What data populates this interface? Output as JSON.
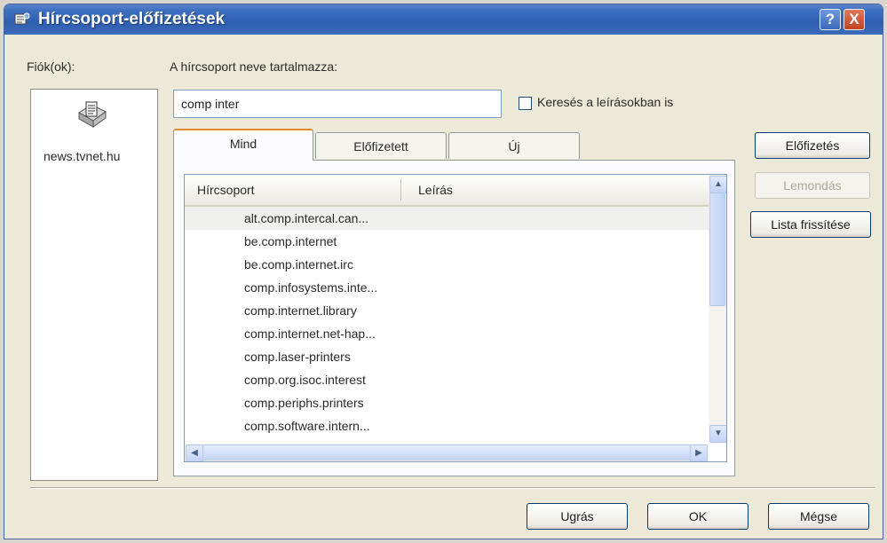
{
  "window": {
    "title": "Hírcsoport-előfizetések",
    "help_label": "?",
    "close_label": "X"
  },
  "accounts": {
    "label": "Fiók(ok):",
    "items": [
      {
        "name": "news.tvnet.hu"
      }
    ]
  },
  "search": {
    "label": "A hírcsoport neve tartalmazza:",
    "value": "comp inter",
    "checkbox_label": "Keresés a leírásokban is",
    "checkbox_checked": false
  },
  "tabs": [
    {
      "label": "Mind",
      "active": true
    },
    {
      "label": "Előfizetett",
      "active": false
    },
    {
      "label": "Új",
      "active": false
    }
  ],
  "list": {
    "columns": [
      "Hírcsoport",
      "Leírás"
    ],
    "rows": [
      {
        "group": "alt.comp.intercal.can...",
        "description": ""
      },
      {
        "group": "be.comp.internet",
        "description": ""
      },
      {
        "group": "be.comp.internet.irc",
        "description": ""
      },
      {
        "group": "comp.infosystems.inte...",
        "description": ""
      },
      {
        "group": "comp.internet.library",
        "description": ""
      },
      {
        "group": "comp.internet.net-hap...",
        "description": ""
      },
      {
        "group": "comp.laser-printers",
        "description": ""
      },
      {
        "group": "comp.org.isoc.interest",
        "description": ""
      },
      {
        "group": "comp.periphs.printers",
        "description": ""
      },
      {
        "group": "comp.software.intern...",
        "description": ""
      }
    ]
  },
  "side_buttons": {
    "subscribe": "Előfizetés",
    "unsubscribe": "Lemondás",
    "refresh": "Lista frissítése"
  },
  "footer_buttons": {
    "goto": "Ugrás",
    "ok": "OK",
    "cancel": "Mégse"
  },
  "colors": {
    "titlebar": "#2f5fb0",
    "dialog_bg": "#ece9d8",
    "active_tab_accent": "#e68b2c"
  }
}
